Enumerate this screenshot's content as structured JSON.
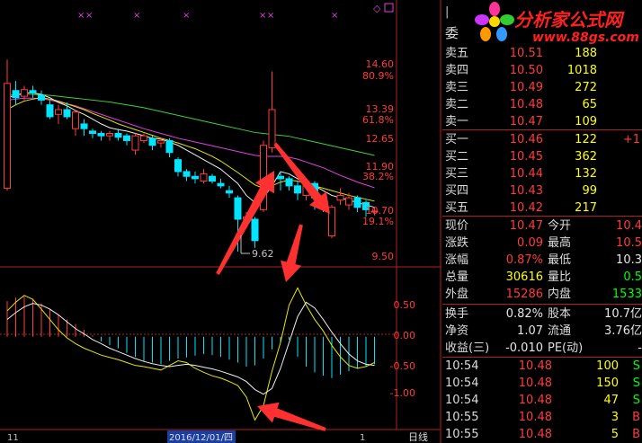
{
  "chart": {
    "price_ticks": [
      "14.60",
      "13.39",
      "12.65",
      "11.90",
      "10.70",
      "9.50"
    ],
    "pct_ticks": [
      "80.9%",
      "61.8%",
      "38.2%",
      "19.1%"
    ],
    "low_label": "9.62",
    "macd_ticks": [
      "0.50",
      "0.00",
      "-0.50",
      "-1.00"
    ],
    "date_label": "2016/12/01/四",
    "left_date": "11",
    "right_date": "1",
    "period_label": "日线",
    "colors": {
      "up": "#ff3b3b",
      "down": "#00e5ff",
      "ma_white": "#f0f0f0",
      "ma_yellow": "#e8e800",
      "ma_magenta": "#e040e0",
      "ma_green": "#40d040",
      "arrow": "#ff3030"
    },
    "candles": [
      {
        "o": 10.95,
        "c": 13.15,
        "h": 13.65,
        "l": 10.9
      },
      {
        "o": 13.0,
        "c": 12.85,
        "h": 13.2,
        "l": 12.7
      },
      {
        "o": 12.88,
        "c": 13.02,
        "h": 13.1,
        "l": 12.8
      },
      {
        "o": 13.0,
        "c": 12.95,
        "h": 13.1,
        "l": 12.85
      },
      {
        "o": 12.9,
        "c": 12.8,
        "h": 13.0,
        "l": 12.7
      },
      {
        "o": 12.7,
        "c": 12.45,
        "h": 12.8,
        "l": 12.4
      },
      {
        "o": 12.5,
        "c": 12.6,
        "h": 12.7,
        "l": 12.3
      },
      {
        "o": 12.6,
        "c": 12.45,
        "h": 12.75,
        "l": 12.4
      },
      {
        "o": 12.2,
        "c": 12.55,
        "h": 12.6,
        "l": 12.05
      },
      {
        "o": 12.3,
        "c": 12.2,
        "h": 12.4,
        "l": 12.05
      },
      {
        "o": 12.15,
        "c": 12.1,
        "h": 12.2,
        "l": 12.0
      },
      {
        "o": 12.1,
        "c": 12.05,
        "h": 12.15,
        "l": 11.95
      },
      {
        "o": 12.05,
        "c": 12.1,
        "h": 12.15,
        "l": 11.95
      },
      {
        "o": 12.1,
        "c": 12.02,
        "h": 12.2,
        "l": 11.95
      },
      {
        "o": 12.05,
        "c": 11.95,
        "h": 12.1,
        "l": 11.85
      },
      {
        "o": 11.75,
        "c": 12.05,
        "h": 12.1,
        "l": 11.65
      },
      {
        "o": 11.95,
        "c": 12.05,
        "h": 12.1,
        "l": 11.9
      },
      {
        "o": 12.0,
        "c": 11.85,
        "h": 12.05,
        "l": 11.75
      },
      {
        "o": 11.9,
        "c": 11.95,
        "h": 12.0,
        "l": 11.8
      },
      {
        "o": 11.95,
        "c": 11.7,
        "h": 12.0,
        "l": 11.6
      },
      {
        "o": 11.55,
        "c": 11.3,
        "h": 11.6,
        "l": 11.2
      },
      {
        "o": 11.3,
        "c": 11.2,
        "h": 11.35,
        "l": 11.1
      },
      {
        "o": 11.2,
        "c": 11.15,
        "h": 11.3,
        "l": 11.05
      },
      {
        "o": 11.1,
        "c": 11.25,
        "h": 11.35,
        "l": 11.05
      },
      {
        "o": 11.2,
        "c": 11.1,
        "h": 11.25,
        "l": 11.05
      },
      {
        "o": 11.05,
        "c": 11.0,
        "h": 11.15,
        "l": 10.95
      },
      {
        "o": 10.9,
        "c": 10.85,
        "h": 11.0,
        "l": 10.75
      },
      {
        "o": 10.75,
        "c": 10.3,
        "h": 10.8,
        "l": 9.62
      },
      {
        "o": 10.3,
        "c": 10.35,
        "h": 10.45,
        "l": 10.2
      },
      {
        "o": 10.3,
        "c": 9.85,
        "h": 10.35,
        "l": 9.7
      },
      {
        "o": 10.5,
        "c": 11.85,
        "h": 11.95,
        "l": 10.45
      },
      {
        "o": 11.8,
        "c": 12.6,
        "h": 13.4,
        "l": 11.7
      },
      {
        "o": 11.2,
        "c": 11.15,
        "h": 11.3,
        "l": 10.9
      },
      {
        "o": 11.15,
        "c": 11.0,
        "h": 11.2,
        "l": 10.9
      },
      {
        "o": 11.0,
        "c": 10.85,
        "h": 11.1,
        "l": 10.7
      },
      {
        "o": 10.8,
        "c": 11.0,
        "h": 11.05,
        "l": 10.7
      },
      {
        "o": 11.05,
        "c": 10.75,
        "h": 11.1,
        "l": 10.5
      },
      {
        "o": 10.75,
        "c": 10.6,
        "h": 10.8,
        "l": 10.45
      },
      {
        "o": 9.95,
        "c": 10.55,
        "h": 10.6,
        "l": 9.9
      },
      {
        "o": 10.7,
        "c": 10.8,
        "h": 10.95,
        "l": 10.6
      },
      {
        "o": 10.6,
        "c": 10.75,
        "h": 10.85,
        "l": 10.5
      },
      {
        "o": 10.75,
        "c": 10.55,
        "h": 10.8,
        "l": 10.45
      },
      {
        "o": 10.65,
        "c": 10.5,
        "h": 10.7,
        "l": 10.35
      },
      {
        "o": 10.45,
        "c": 10.47,
        "h": 10.55,
        "l": 10.38
      }
    ],
    "ma_white": [
      12.85,
      12.9,
      12.95,
      12.95,
      12.92,
      12.85,
      12.75,
      12.68,
      12.58,
      12.5,
      12.4,
      12.3,
      12.22,
      12.18,
      12.15,
      12.1,
      12.05,
      12.0,
      11.98,
      11.92,
      11.85,
      11.75,
      11.65,
      11.55,
      11.45,
      11.35,
      11.2,
      11.05,
      10.8,
      10.65,
      10.75,
      11.0,
      11.3,
      11.25,
      11.15,
      11.05,
      11.0,
      10.9,
      10.8,
      10.75,
      10.7,
      10.65,
      10.6,
      10.55
    ],
    "ma_yellow": [
      12.6,
      12.7,
      12.78,
      12.82,
      12.85,
      12.82,
      12.78,
      12.72,
      12.66,
      12.6,
      12.52,
      12.45,
      12.38,
      12.3,
      12.24,
      12.18,
      12.12,
      12.06,
      12.0,
      11.95,
      11.9,
      11.84,
      11.78,
      11.7,
      11.62,
      11.52,
      11.4,
      11.28,
      11.15,
      11.02,
      10.95,
      11.0,
      11.08,
      11.12,
      11.1,
      11.05,
      11.0,
      10.95,
      10.9,
      10.85,
      10.8,
      10.76,
      10.72,
      10.68
    ],
    "ma_magenta": [
      12.8,
      12.82,
      12.84,
      12.84,
      12.83,
      12.8,
      12.76,
      12.72,
      12.68,
      12.62,
      12.56,
      12.5,
      12.44,
      12.38,
      12.32,
      12.26,
      12.2,
      12.15,
      12.1,
      12.05,
      12.0,
      11.96,
      11.92,
      11.88,
      11.84,
      11.8,
      11.76,
      11.72,
      11.68,
      11.64,
      11.62,
      11.62,
      11.62,
      11.6,
      11.56,
      11.5,
      11.44,
      11.38,
      11.3,
      11.22,
      11.15,
      11.08,
      11.02,
      10.96
    ],
    "ma_green": [
      12.9,
      12.91,
      12.92,
      12.92,
      12.91,
      12.9,
      12.88,
      12.86,
      12.84,
      12.82,
      12.8,
      12.78,
      12.76,
      12.73,
      12.7,
      12.67,
      12.64,
      12.6,
      12.56,
      12.52,
      12.48,
      12.44,
      12.4,
      12.36,
      12.32,
      12.28,
      12.24,
      12.2,
      12.16,
      12.12,
      12.1,
      12.08,
      12.06,
      12.04,
      12.0,
      11.96,
      11.92,
      11.88,
      11.84,
      11.8,
      11.76,
      11.72,
      11.68,
      11.64
    ],
    "macd_hist": [
      0.62,
      0.68,
      0.7,
      0.66,
      0.58,
      0.48,
      0.38,
      0.3,
      0.22,
      0.12,
      0.02,
      -0.08,
      -0.15,
      -0.2,
      -0.28,
      -0.35,
      -0.42,
      -0.45,
      -0.48,
      -0.42,
      -0.38,
      -0.36,
      -0.33,
      -0.3,
      -0.32,
      -0.35,
      -0.4,
      -0.45,
      -0.52,
      -0.5,
      -0.38,
      -0.22,
      -0.1,
      -0.05,
      -0.35,
      -0.52,
      -0.62,
      -0.68,
      -0.72,
      -0.66,
      -0.6,
      -0.56,
      -0.52,
      -0.48
    ],
    "macd_dif": [
      0.45,
      0.6,
      0.72,
      0.65,
      0.48,
      0.3,
      0.12,
      -0.02,
      -0.12,
      -0.2,
      -0.26,
      -0.32,
      -0.36,
      -0.4,
      -0.45,
      -0.5,
      -0.52,
      -0.55,
      -0.58,
      -0.5,
      -0.42,
      -0.45,
      -0.55,
      -0.62,
      -0.68,
      -0.72,
      -0.78,
      -0.85,
      -1.05,
      -1.45,
      -1.2,
      -0.6,
      -0.1,
      0.55,
      0.85,
      0.55,
      0.3,
      0.1,
      -0.15,
      -0.35,
      -0.5,
      -0.55,
      -0.52,
      -0.45
    ],
    "macd_dea": [
      0.3,
      0.42,
      0.52,
      0.58,
      0.55,
      0.48,
      0.38,
      0.26,
      0.14,
      0.05,
      -0.05,
      -0.12,
      -0.2,
      -0.26,
      -0.32,
      -0.38,
      -0.43,
      -0.47,
      -0.5,
      -0.52,
      -0.5,
      -0.48,
      -0.5,
      -0.53,
      -0.56,
      -0.6,
      -0.65,
      -0.7,
      -0.78,
      -0.92,
      -1.0,
      -0.9,
      -0.55,
      -0.1,
      0.35,
      0.6,
      0.5,
      0.3,
      0.08,
      -0.12,
      -0.3,
      -0.42,
      -0.48,
      -0.5
    ],
    "price_range": [
      9.3,
      14.9
    ],
    "macd_range": [
      -1.6,
      1.2
    ]
  },
  "panel": {
    "header_label": "委",
    "logo_text": "分析家公式网",
    "logo_url": "www.88gs.com",
    "sells": [
      {
        "label": "卖五",
        "price": "10.51",
        "vol": "188"
      },
      {
        "label": "卖四",
        "price": "10.50",
        "vol": "1018"
      },
      {
        "label": "卖三",
        "price": "10.49",
        "vol": "272"
      },
      {
        "label": "卖二",
        "price": "10.48",
        "vol": "65"
      },
      {
        "label": "卖一",
        "price": "10.47",
        "vol": "109"
      }
    ],
    "buys": [
      {
        "label": "买一",
        "price": "10.46",
        "vol": "122",
        "extra": "+1"
      },
      {
        "label": "买二",
        "price": "10.45",
        "vol": "362",
        "extra": ""
      },
      {
        "label": "买三",
        "price": "10.44",
        "vol": "132",
        "extra": ""
      },
      {
        "label": "买四",
        "price": "10.43",
        "vol": "99",
        "extra": ""
      },
      {
        "label": "买五",
        "price": "10.42",
        "vol": "217",
        "extra": ""
      }
    ],
    "stats": [
      {
        "l1": "现价",
        "v1": "10.47",
        "c1": "red",
        "l2": "今开",
        "v2": "10.4",
        "c2": "red"
      },
      {
        "l1": "涨跌",
        "v1": "0.09",
        "c1": "red",
        "l2": "最高",
        "v2": "10.5",
        "c2": "red"
      },
      {
        "l1": "涨幅",
        "v1": "0.87%",
        "c1": "red",
        "l2": "最低",
        "v2": "10.3",
        "c2": "wht"
      },
      {
        "l1": "总量",
        "v1": "30616",
        "c1": "yel",
        "l2": "量比",
        "v2": "0.5",
        "c2": "grn"
      },
      {
        "l1": "外盘",
        "v1": "15286",
        "c1": "red",
        "l2": "内盘",
        "v2": "1533",
        "c2": "grn"
      }
    ],
    "stats2": [
      {
        "l1": "换手",
        "v1": "0.82%",
        "l2": "股本",
        "v2": "10.7亿"
      },
      {
        "l1": "净资",
        "v1": "1.07",
        "l2": "流通",
        "v2": "3.76亿"
      },
      {
        "l1": "收益(三)",
        "v1": "-0.010",
        "l2": "PE(动)",
        "v2": "-"
      }
    ],
    "ticks": [
      {
        "time": "10:54",
        "price": "10.48",
        "vol": "100",
        "dir": "S"
      },
      {
        "time": "10:54",
        "price": "10.48",
        "vol": "150",
        "dir": "S"
      },
      {
        "time": "10:54",
        "price": "10.48",
        "vol": "47",
        "dir": "S"
      },
      {
        "time": "10:55",
        "price": "10.48",
        "vol": "3",
        "dir": "B"
      },
      {
        "time": "10:55",
        "price": "10.48",
        "vol": "5",
        "dir": "B"
      }
    ]
  }
}
